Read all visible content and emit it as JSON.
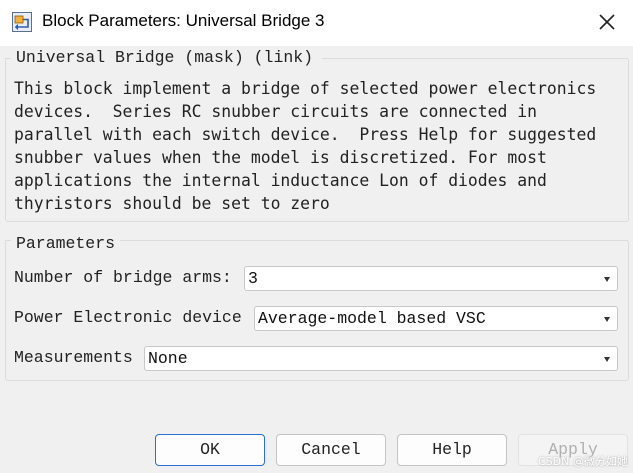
{
  "window": {
    "title": "Block Parameters: Universal Bridge 3",
    "app_icon": "simulink-block-icon",
    "close_icon": "close-icon"
  },
  "description": {
    "legend": "Universal Bridge (mask) (link)",
    "text": "This block implement a bridge of selected power electronics\ndevices.  Series RC snubber circuits are connected in\nparallel with each switch device.  Press Help for suggested\nsnubber values when the model is discretized. For most\napplications the internal inductance Lon of diodes and\nthyristors should be set to zero"
  },
  "parameters": {
    "legend": "Parameters",
    "bridge_arms": {
      "label": "Number of bridge arms:",
      "value": "3"
    },
    "device": {
      "label": "Power Electronic device",
      "value": "Average-model based VSC"
    },
    "measurements": {
      "label": "Measurements",
      "value": "None"
    }
  },
  "buttons": {
    "ok": "OK",
    "cancel": "Cancel",
    "help": "Help",
    "apply": "Apply"
  },
  "watermark": "CSDN @微分如她"
}
